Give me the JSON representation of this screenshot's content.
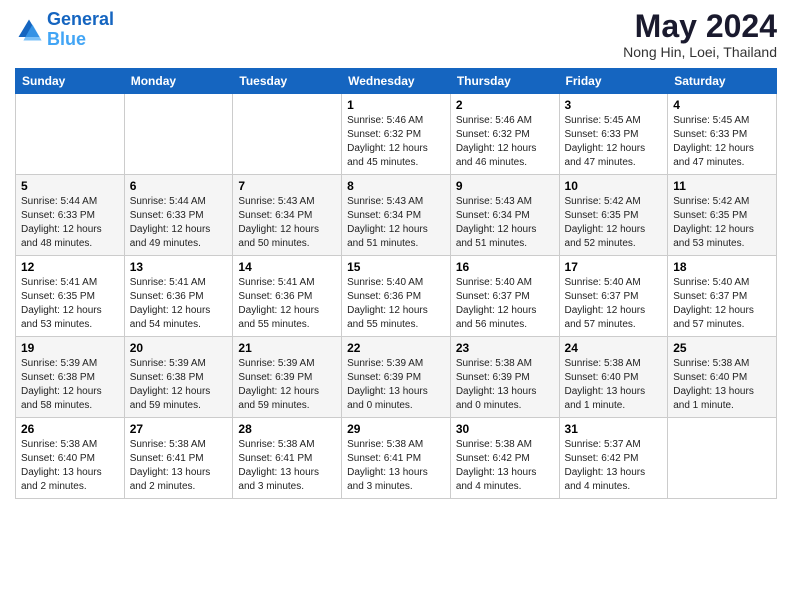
{
  "header": {
    "logo_line1": "General",
    "logo_line2": "Blue",
    "title": "May 2024",
    "subtitle": "Nong Hin, Loei, Thailand"
  },
  "weekdays": [
    "Sunday",
    "Monday",
    "Tuesday",
    "Wednesday",
    "Thursday",
    "Friday",
    "Saturday"
  ],
  "weeks": [
    [
      {
        "day": "",
        "info": ""
      },
      {
        "day": "",
        "info": ""
      },
      {
        "day": "",
        "info": ""
      },
      {
        "day": "1",
        "info": "Sunrise: 5:46 AM\nSunset: 6:32 PM\nDaylight: 12 hours\nand 45 minutes."
      },
      {
        "day": "2",
        "info": "Sunrise: 5:46 AM\nSunset: 6:32 PM\nDaylight: 12 hours\nand 46 minutes."
      },
      {
        "day": "3",
        "info": "Sunrise: 5:45 AM\nSunset: 6:33 PM\nDaylight: 12 hours\nand 47 minutes."
      },
      {
        "day": "4",
        "info": "Sunrise: 5:45 AM\nSunset: 6:33 PM\nDaylight: 12 hours\nand 47 minutes."
      }
    ],
    [
      {
        "day": "5",
        "info": "Sunrise: 5:44 AM\nSunset: 6:33 PM\nDaylight: 12 hours\nand 48 minutes."
      },
      {
        "day": "6",
        "info": "Sunrise: 5:44 AM\nSunset: 6:33 PM\nDaylight: 12 hours\nand 49 minutes."
      },
      {
        "day": "7",
        "info": "Sunrise: 5:43 AM\nSunset: 6:34 PM\nDaylight: 12 hours\nand 50 minutes."
      },
      {
        "day": "8",
        "info": "Sunrise: 5:43 AM\nSunset: 6:34 PM\nDaylight: 12 hours\nand 51 minutes."
      },
      {
        "day": "9",
        "info": "Sunrise: 5:43 AM\nSunset: 6:34 PM\nDaylight: 12 hours\nand 51 minutes."
      },
      {
        "day": "10",
        "info": "Sunrise: 5:42 AM\nSunset: 6:35 PM\nDaylight: 12 hours\nand 52 minutes."
      },
      {
        "day": "11",
        "info": "Sunrise: 5:42 AM\nSunset: 6:35 PM\nDaylight: 12 hours\nand 53 minutes."
      }
    ],
    [
      {
        "day": "12",
        "info": "Sunrise: 5:41 AM\nSunset: 6:35 PM\nDaylight: 12 hours\nand 53 minutes."
      },
      {
        "day": "13",
        "info": "Sunrise: 5:41 AM\nSunset: 6:36 PM\nDaylight: 12 hours\nand 54 minutes."
      },
      {
        "day": "14",
        "info": "Sunrise: 5:41 AM\nSunset: 6:36 PM\nDaylight: 12 hours\nand 55 minutes."
      },
      {
        "day": "15",
        "info": "Sunrise: 5:40 AM\nSunset: 6:36 PM\nDaylight: 12 hours\nand 55 minutes."
      },
      {
        "day": "16",
        "info": "Sunrise: 5:40 AM\nSunset: 6:37 PM\nDaylight: 12 hours\nand 56 minutes."
      },
      {
        "day": "17",
        "info": "Sunrise: 5:40 AM\nSunset: 6:37 PM\nDaylight: 12 hours\nand 57 minutes."
      },
      {
        "day": "18",
        "info": "Sunrise: 5:40 AM\nSunset: 6:37 PM\nDaylight: 12 hours\nand 57 minutes."
      }
    ],
    [
      {
        "day": "19",
        "info": "Sunrise: 5:39 AM\nSunset: 6:38 PM\nDaylight: 12 hours\nand 58 minutes."
      },
      {
        "day": "20",
        "info": "Sunrise: 5:39 AM\nSunset: 6:38 PM\nDaylight: 12 hours\nand 59 minutes."
      },
      {
        "day": "21",
        "info": "Sunrise: 5:39 AM\nSunset: 6:39 PM\nDaylight: 12 hours\nand 59 minutes."
      },
      {
        "day": "22",
        "info": "Sunrise: 5:39 AM\nSunset: 6:39 PM\nDaylight: 13 hours\nand 0 minutes."
      },
      {
        "day": "23",
        "info": "Sunrise: 5:38 AM\nSunset: 6:39 PM\nDaylight: 13 hours\nand 0 minutes."
      },
      {
        "day": "24",
        "info": "Sunrise: 5:38 AM\nSunset: 6:40 PM\nDaylight: 13 hours\nand 1 minute."
      },
      {
        "day": "25",
        "info": "Sunrise: 5:38 AM\nSunset: 6:40 PM\nDaylight: 13 hours\nand 1 minute."
      }
    ],
    [
      {
        "day": "26",
        "info": "Sunrise: 5:38 AM\nSunset: 6:40 PM\nDaylight: 13 hours\nand 2 minutes."
      },
      {
        "day": "27",
        "info": "Sunrise: 5:38 AM\nSunset: 6:41 PM\nDaylight: 13 hours\nand 2 minutes."
      },
      {
        "day": "28",
        "info": "Sunrise: 5:38 AM\nSunset: 6:41 PM\nDaylight: 13 hours\nand 3 minutes."
      },
      {
        "day": "29",
        "info": "Sunrise: 5:38 AM\nSunset: 6:41 PM\nDaylight: 13 hours\nand 3 minutes."
      },
      {
        "day": "30",
        "info": "Sunrise: 5:38 AM\nSunset: 6:42 PM\nDaylight: 13 hours\nand 4 minutes."
      },
      {
        "day": "31",
        "info": "Sunrise: 5:37 AM\nSunset: 6:42 PM\nDaylight: 13 hours\nand 4 minutes."
      },
      {
        "day": "",
        "info": ""
      }
    ]
  ]
}
